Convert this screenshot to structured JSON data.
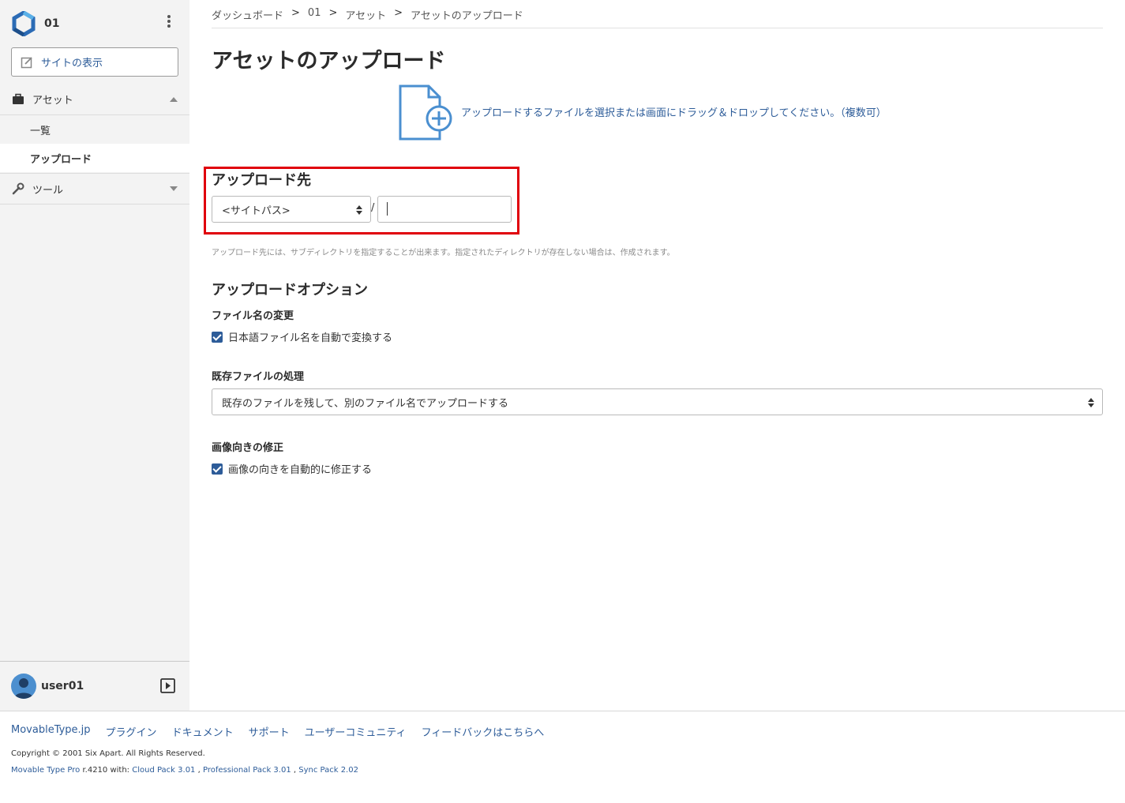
{
  "sidebar": {
    "site_name": "01",
    "view_site_label": "サイトの表示",
    "asset_label": "アセット",
    "asset_items": [
      "一覧",
      "アップロード"
    ],
    "tools_label": "ツール",
    "username": "user01"
  },
  "breadcrumb": {
    "items": [
      "ダッシュボード",
      "01",
      "アセット",
      "アセットのアップロード"
    ],
    "separator": ">"
  },
  "main": {
    "title": "アセットのアップロード",
    "drop_zone_text": "アップロードするファイルを選択または画面にドラッグ＆ドロップしてください。（複数可）",
    "destination": {
      "heading": "アップロード先",
      "site_path_value": "<サイトパス>",
      "slash": "/",
      "subdir_value": "",
      "hint": "アップロード先には、サブディレクトリを指定することが出来ます。指定されたディレクトリが存在しない場合は、作成されます。"
    },
    "options": {
      "heading": "アップロードオプション",
      "rename_heading": "ファイル名の変更",
      "rename_checkbox": "日本語ファイル名を自動で変換する",
      "rename_checked": true,
      "existing_heading": "既存ファイルの処理",
      "existing_value": "既存のファイルを残して、別のファイル名でアップロードする",
      "orientation_heading": "画像向きの修正",
      "orientation_checkbox": "画像の向きを自動的に修正する",
      "orientation_checked": true
    }
  },
  "footer": {
    "links": [
      "MovableType.jp",
      "プラグイン",
      "ドキュメント",
      "サポート",
      "ユーザーコミュニティ",
      "フィードバックはこちらへ"
    ],
    "copyright": "Copyright © 2001 Six Apart. All Rights Reserved.",
    "version_product": "Movable Type Pro",
    "version_text": "r.4210 with:",
    "packs": [
      "Cloud Pack 3.01",
      "Professional Pack 3.01",
      "Sync Pack 2.02"
    ]
  },
  "colors": {
    "link_blue": "#2d5c99",
    "highlight_red": "#e0000b",
    "sidebar_bg": "#f3f3f3"
  },
  "icons": [
    "movable-type-logo-icon",
    "kebab-menu-icon",
    "external-edit-icon",
    "briefcase-icon",
    "caret-up-icon",
    "wrench-icon",
    "caret-down-icon",
    "user-avatar-icon",
    "play-collapse-icon",
    "file-add-icon"
  ]
}
